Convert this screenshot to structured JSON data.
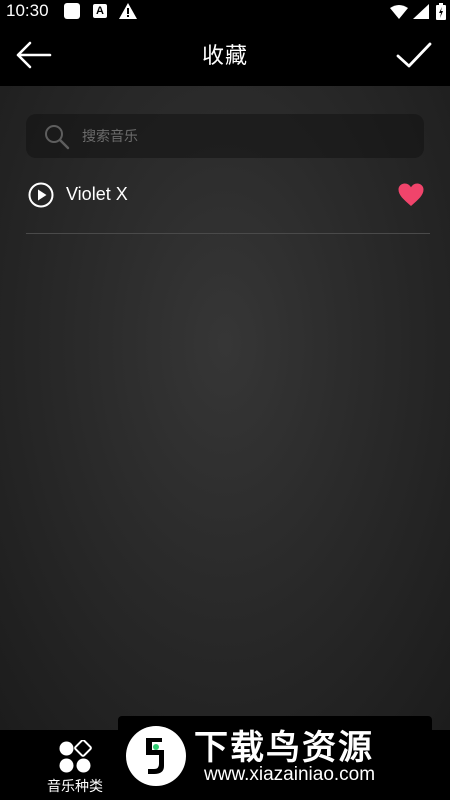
{
  "status_bar": {
    "time": "10:30",
    "notification_badge": "A"
  },
  "header": {
    "title": "收藏",
    "back_icon": "arrow-left-icon",
    "confirm_icon": "checkmark-icon"
  },
  "search": {
    "placeholder": "搜索音乐",
    "value": ""
  },
  "songs": [
    {
      "title": "Violet X",
      "favorited": true,
      "play_icon": "play-circle-icon",
      "heart_color": "#f0446b"
    }
  ],
  "bottom_nav": {
    "items": [
      {
        "label": "音乐种类",
        "icon": "categories-icon"
      }
    ]
  },
  "watermark": {
    "title": "下载鸟资源",
    "url": "www.xiazainiao.com"
  },
  "colors": {
    "background": "#000000",
    "content_bg": "#2a2a2a",
    "accent": "#f0446b",
    "text": "#ffffff"
  }
}
